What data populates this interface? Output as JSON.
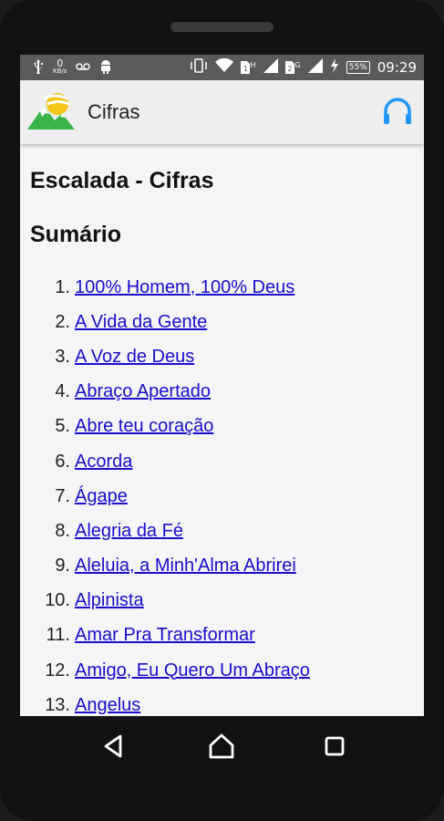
{
  "status_bar": {
    "speed_value": "0",
    "speed_unit": "KB/s",
    "battery": "55%",
    "time": "09:29",
    "sim1": "H",
    "sim2": "G"
  },
  "app_bar": {
    "title": "Cifras",
    "logo_icon": "mountain-sun-logo",
    "action_icon": "headphones-icon",
    "accent_color": "#2196f3"
  },
  "main": {
    "page_title": "Escalada - Cifras",
    "section_title": "Sumário",
    "items": [
      {
        "num": "1.",
        "label": "100% Homem, 100% Deus"
      },
      {
        "num": "2.",
        "label": "A Vida da Gente"
      },
      {
        "num": "3.",
        "label": "A Voz de Deus"
      },
      {
        "num": "4.",
        "label": "Abraço Apertado"
      },
      {
        "num": "5.",
        "label": "Abre teu coração"
      },
      {
        "num": "6.",
        "label": "Acorda"
      },
      {
        "num": "7.",
        "label": "Ágape"
      },
      {
        "num": "8.",
        "label": "Alegria da Fé"
      },
      {
        "num": "9.",
        "label": "Aleluia, a Minh'Alma Abrirei"
      },
      {
        "num": "10.",
        "label": "Alpinista"
      },
      {
        "num": "11.",
        "label": "Amar Pra Transformar"
      },
      {
        "num": "12.",
        "label": "Amigo, Eu Quero Um Abraço"
      },
      {
        "num": "13.",
        "label": "Angelus"
      }
    ]
  },
  "nav_bar": {
    "back_icon": "back-triangle-icon",
    "home_icon": "home-icon",
    "recents_icon": "recents-square-icon"
  }
}
